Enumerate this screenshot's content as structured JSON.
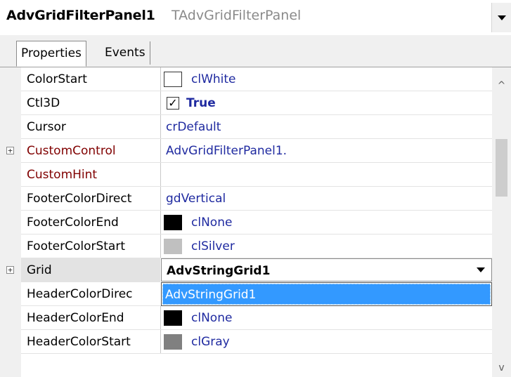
{
  "header": {
    "component_name": "AdvGridFilterPanel1",
    "component_type": "TAdvGridFilterPanel"
  },
  "tabs": [
    {
      "label": "Properties",
      "active": true
    },
    {
      "label": "Events",
      "active": false
    }
  ],
  "properties": [
    {
      "name": "ColorStart",
      "value": "clWhite",
      "swatch": "#ffffff",
      "expandable": false,
      "red": false
    },
    {
      "name": "Ctl3D",
      "value": "True",
      "checkbox": true,
      "expandable": false,
      "red": false
    },
    {
      "name": "Cursor",
      "value": "crDefault",
      "expandable": false,
      "red": false
    },
    {
      "name": "CustomControl",
      "value": "AdvGridFilterPanel1.",
      "expandable": true,
      "red": true
    },
    {
      "name": "CustomHint",
      "value": "",
      "expandable": false,
      "red": true
    },
    {
      "name": "FooterColorDirect",
      "value": "gdVertical",
      "expandable": false,
      "red": false
    },
    {
      "name": "FooterColorEnd",
      "value": "clNone",
      "swatch": "#000000",
      "expandable": false,
      "red": false
    },
    {
      "name": "FooterColorStart",
      "value": "clSilver",
      "swatch": "#c0c0c0",
      "expandable": false,
      "red": false
    },
    {
      "name": "Grid",
      "value": "AdvStringGrid1",
      "expandable": true,
      "red": false,
      "editing": true
    },
    {
      "name": "HeaderColorDirec",
      "value": "",
      "expandable": false,
      "red": false
    },
    {
      "name": "HeaderColorEnd",
      "value": "clNone",
      "swatch": "#000000",
      "expandable": false,
      "red": false
    },
    {
      "name": "HeaderColorStart",
      "value": "clGray",
      "swatch": "#808080",
      "expandable": false,
      "red": false
    }
  ],
  "dropdown": {
    "items": [
      "AdvStringGrid1"
    ],
    "selected": "AdvStringGrid1"
  },
  "icons": {
    "expand": "plus-box-icon",
    "combo": "chevron-down-icon",
    "scroll_up": "scroll-up-arrow-icon",
    "scroll_down": "scroll-down-arrow-icon"
  },
  "glyphs": {
    "expand": "+",
    "check": "✓",
    "scroll_up": "^",
    "scroll_down": "v"
  },
  "colors": {
    "value_text": "#1f2aa0",
    "category_text": "#800000",
    "selection": "#3399ff"
  }
}
